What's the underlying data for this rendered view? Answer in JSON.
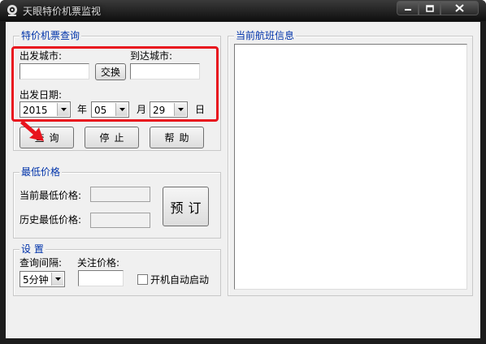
{
  "window": {
    "title": "天眼特价机票监视"
  },
  "colors": {
    "legend": "#0033aa",
    "annotation": "#e8141e",
    "titlebar": "#1c1c1c"
  },
  "query_group": {
    "legend": "特价机票查询",
    "depart_label": "出发城市:",
    "depart_value": "",
    "swap_label": "交换",
    "arrive_label": "到达城市:",
    "arrive_value": "",
    "date_label": "出发日期:",
    "year_value": "2015",
    "year_unit": "年",
    "month_value": "05",
    "month_unit": "月",
    "day_value": "29",
    "day_unit": "日"
  },
  "actions": {
    "query_label": "查询",
    "stop_label": "停止",
    "help_label": "帮助"
  },
  "price_group": {
    "legend": "最低价格",
    "current_label": "当前最低价格:",
    "current_value": "",
    "history_label": "历史最低价格:",
    "history_value": "",
    "book_label": "预订"
  },
  "settings_group": {
    "legend": "设 置",
    "interval_label": "查询间隔:",
    "interval_value": "5分钟",
    "watch_price_label": "关注价格:",
    "watch_price_value": "",
    "autostart_label": "开机自动启动",
    "autostart_checked": false
  },
  "flights_group": {
    "legend": "当前航班信息"
  },
  "icons": [
    "app-eye-icon",
    "minimize-icon",
    "maximize-icon",
    "close-icon",
    "chevron-down-icon",
    "annotation-arrow-icon"
  ]
}
